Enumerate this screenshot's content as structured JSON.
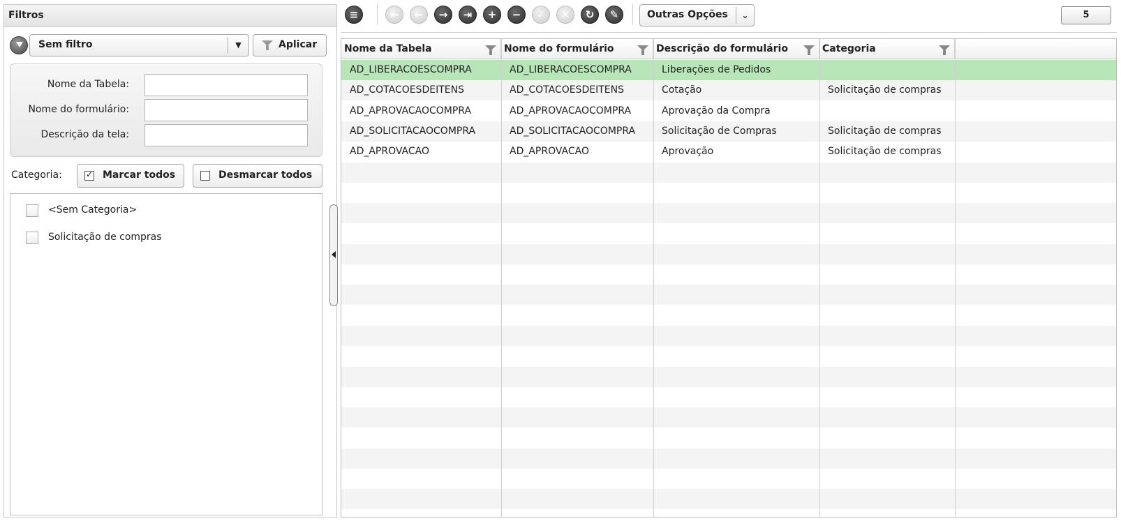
{
  "filters": {
    "header": "Filtros",
    "select_value": "Sem filtro",
    "apply_label": "Aplicar",
    "fields": [
      {
        "label": "Nome da Tabela:",
        "value": ""
      },
      {
        "label": "Nome do formulário:",
        "value": ""
      },
      {
        "label": "Descrição da tela:",
        "value": ""
      }
    ],
    "category_label": "Categoria:",
    "check_all_label": "Marcar todos",
    "uncheck_all_label": "Desmarcar todos",
    "categories": [
      {
        "label": "<Sem Categoria>",
        "checked": false
      },
      {
        "label": "Solicitação de compras",
        "checked": false
      }
    ]
  },
  "toolbar": {
    "options_label": "Outras Opções",
    "record_count": "5",
    "icons": [
      "menu-icon",
      "first-record-icon",
      "previous-record-icon",
      "next-record-icon",
      "last-record-icon",
      "add-icon",
      "remove-icon",
      "confirm-icon",
      "cancel-icon",
      "refresh-icon",
      "edit-icon"
    ]
  },
  "grid": {
    "columns": [
      "Nome da Tabela",
      "Nome do formulário",
      "Descrição do formulário",
      "Categoria"
    ],
    "rows": [
      [
        "AD_LIBERACOESCOMPRA",
        "AD_LIBERACOESCOMPRA",
        "Liberações de Pedidos",
        ""
      ],
      [
        "AD_COTACOESDEITENS",
        "AD_COTACOESDEITENS",
        "Cotação",
        "Solicitação de compras"
      ],
      [
        "AD_APROVACAOCOMPRA",
        "AD_APROVACAOCOMPRA",
        "Aprovação da Compra",
        ""
      ],
      [
        "AD_SOLICITACAOCOMPRA",
        "AD_SOLICITACAOCOMPRA",
        "Solicitação de Compras",
        "Solicitação de compras"
      ],
      [
        "AD_APROVACAO",
        "AD_APROVACAO",
        "Aprovação",
        "Solicitação de compras"
      ]
    ],
    "selected_row": 0
  },
  "colors": {
    "selected_row": "#b8e6b8",
    "alt_row": "#f4f4f4"
  }
}
